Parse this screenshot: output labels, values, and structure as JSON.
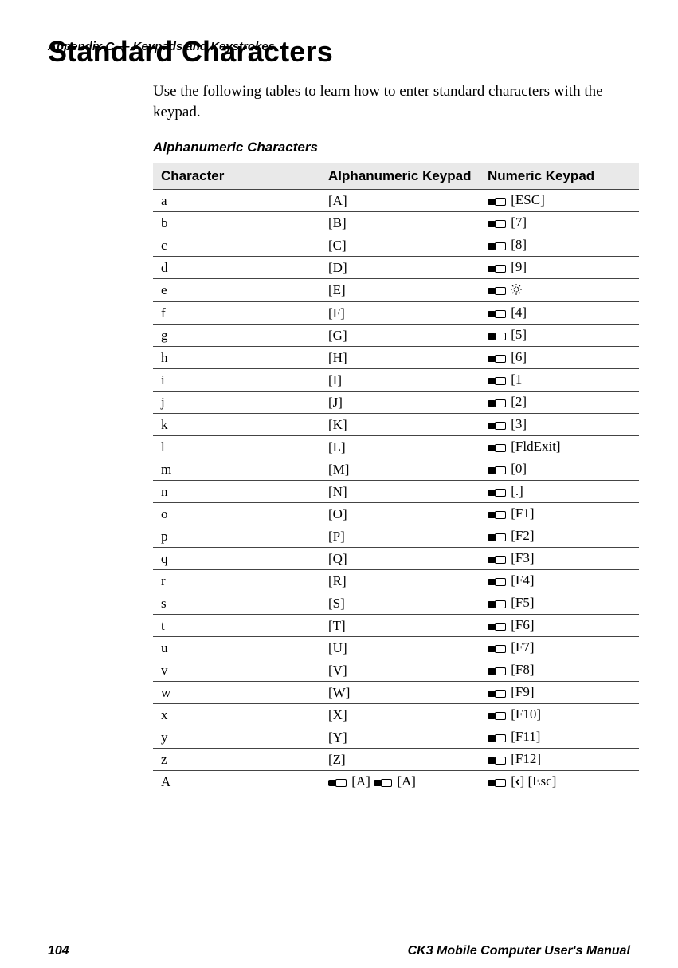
{
  "header": {
    "running_head": "Appendix C — Keypads and Keystrokes"
  },
  "title": "Standard Characters",
  "intro": "Use the following tables to learn how to enter standard characters with the keypad.",
  "table": {
    "title": "Alphanumeric Characters",
    "columns": {
      "c1": "Character",
      "c2": "Alphanumeric Keypad",
      "c3": "Numeric Keypad"
    },
    "rows": [
      {
        "char": "a",
        "alpha": "[A]",
        "numeric_mods": 1,
        "numeric_suffix": "[ESC]"
      },
      {
        "char": "b",
        "alpha": "[B]",
        "numeric_mods": 1,
        "numeric_suffix": "[7]"
      },
      {
        "char": "c",
        "alpha": "[C]",
        "numeric_mods": 1,
        "numeric_suffix": "[8]"
      },
      {
        "char": "d",
        "alpha": "[D]",
        "numeric_mods": 1,
        "numeric_suffix": "[9]"
      },
      {
        "char": "e",
        "alpha": "[E]",
        "numeric_mods": 1,
        "numeric_suffix": "",
        "numeric_backlight": true
      },
      {
        "char": "f",
        "alpha": "[F]",
        "numeric_mods": 1,
        "numeric_suffix": "[4]"
      },
      {
        "char": "g",
        "alpha": "[G]",
        "numeric_mods": 1,
        "numeric_suffix": "[5]"
      },
      {
        "char": "h",
        "alpha": "[H]",
        "numeric_mods": 1,
        "numeric_suffix": "[6]"
      },
      {
        "char": "i",
        "alpha": "[I]",
        "numeric_mods": 1,
        "numeric_suffix": "[1"
      },
      {
        "char": "j",
        "alpha": "[J]",
        "numeric_mods": 1,
        "numeric_suffix": "[2]"
      },
      {
        "char": "k",
        "alpha": "[K]",
        "numeric_mods": 1,
        "numeric_suffix": "[3]"
      },
      {
        "char": "l",
        "alpha": "[L]",
        "numeric_mods": 1,
        "numeric_suffix": "[FldExit]"
      },
      {
        "char": "m",
        "alpha": "[M]",
        "numeric_mods": 1,
        "numeric_suffix": "[0]"
      },
      {
        "char": "n",
        "alpha": "[N]",
        "numeric_mods": 1,
        "numeric_suffix": "[.]"
      },
      {
        "char": "o",
        "alpha": "[O]",
        "numeric_mods": 1,
        "numeric_suffix": "[F1]"
      },
      {
        "char": "p",
        "alpha": "[P]",
        "numeric_mods": 1,
        "numeric_suffix": "[F2]"
      },
      {
        "char": "q",
        "alpha": "[Q]",
        "numeric_mods": 1,
        "numeric_suffix": "[F3]"
      },
      {
        "char": "r",
        "alpha": "[R]",
        "numeric_mods": 1,
        "numeric_suffix": "[F4]"
      },
      {
        "char": "s",
        "alpha": "[S]",
        "numeric_mods": 1,
        "numeric_suffix": "[F5]"
      },
      {
        "char": "t",
        "alpha": "[T]",
        "numeric_mods": 1,
        "numeric_suffix": "[F6]"
      },
      {
        "char": "u",
        "alpha": "[U]",
        "numeric_mods": 1,
        "numeric_suffix": "[F7]"
      },
      {
        "char": "v",
        "alpha": "[V]",
        "numeric_mods": 1,
        "numeric_suffix": "[F8]"
      },
      {
        "char": "w",
        "alpha": "[W]",
        "numeric_mods": 1,
        "numeric_suffix": "[F9]"
      },
      {
        "char": "x",
        "alpha": "[X]",
        "numeric_mods": 1,
        "numeric_suffix": "[F10]"
      },
      {
        "char": "y",
        "alpha": "[Y]",
        "numeric_mods": 1,
        "numeric_suffix": "[F11]"
      },
      {
        "char": "z",
        "alpha": "[Z]",
        "numeric_mods": 1,
        "numeric_suffix": "[F12]"
      },
      {
        "char": "A",
        "alpha_parts": [
          {
            "mod": true,
            "text": "[A]"
          },
          {
            "mod": true,
            "text": "[A]"
          }
        ],
        "numeric_mods": 1,
        "numeric_suffix": "[ ] [Esc]",
        "numeric_left_arrow": true
      }
    ]
  },
  "footer": {
    "page": "104",
    "manual": "CK3 Mobile Computer User's Manual"
  }
}
